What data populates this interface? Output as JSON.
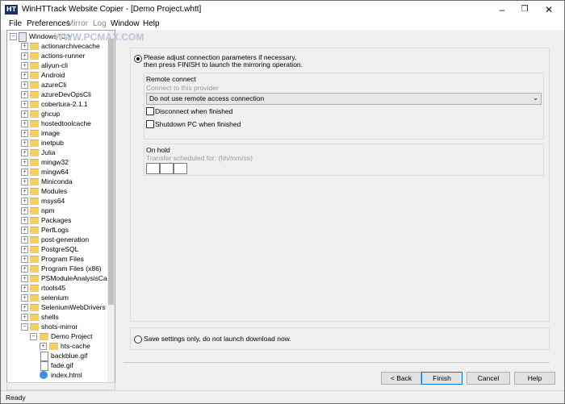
{
  "window": {
    "title": "WinHTTrack Website Copier - [Demo Project.whtt]",
    "icon_text": "HT",
    "controls": [
      "minimize-icon",
      "restore-icon",
      "close-icon"
    ]
  },
  "menu": {
    "items": [
      "File",
      "Preferences",
      "Mirror",
      "Log",
      "Window",
      "Help"
    ]
  },
  "tree": {
    "root": "Windows (C:)",
    "items": [
      "actionarchivecache",
      "actions-runner",
      "aliyun-cli",
      "Android",
      "azureCli",
      "azureDevOpsCli",
      "cobertura-2.1.1",
      "ghcup",
      "hostedtoolcache",
      "image",
      "inetpub",
      "Julia",
      "mingw32",
      "mingw64",
      "Miniconda",
      "Modules",
      "msys64",
      "npm",
      "Packages",
      "PerfLogs",
      "post-generation",
      "PostgreSQL",
      "Program Files",
      "Program Files (x86)",
      "PSModuleAnalysisCach",
      "rtools45",
      "selenium",
      "SeleniumWebDrivers",
      "shells",
      "shots-mirror"
    ],
    "sub_folder": "Demo Project",
    "sub_sub_folder": "hts-cache",
    "files": [
      "backblue.gif",
      "fade.gif",
      "index.html"
    ]
  },
  "watermark": "WWW.PCMAX.COM",
  "options": {
    "intro_line1": "Please adjust connection parameters if necessary,",
    "intro_line2": "then press FINISH to launch the mirroring operation.",
    "remote_connect_title": "Remote connect",
    "connect_provider_label": "Connect to this provider",
    "provider_selected": "Do not use remote access connection",
    "disconnect_label": "Disconnect when finished",
    "shutdown_label": "Shutdown PC when finished",
    "on_hold_title": "On hold",
    "transfer_label": "Transfer scheduled for: (hh/mm/ss)",
    "save_only_label": "Save settings only, do not launch download now."
  },
  "buttons": {
    "back": "< Back",
    "finish": "Finish",
    "cancel": "Cancel",
    "help": "Help"
  },
  "status": {
    "text": "Ready"
  }
}
